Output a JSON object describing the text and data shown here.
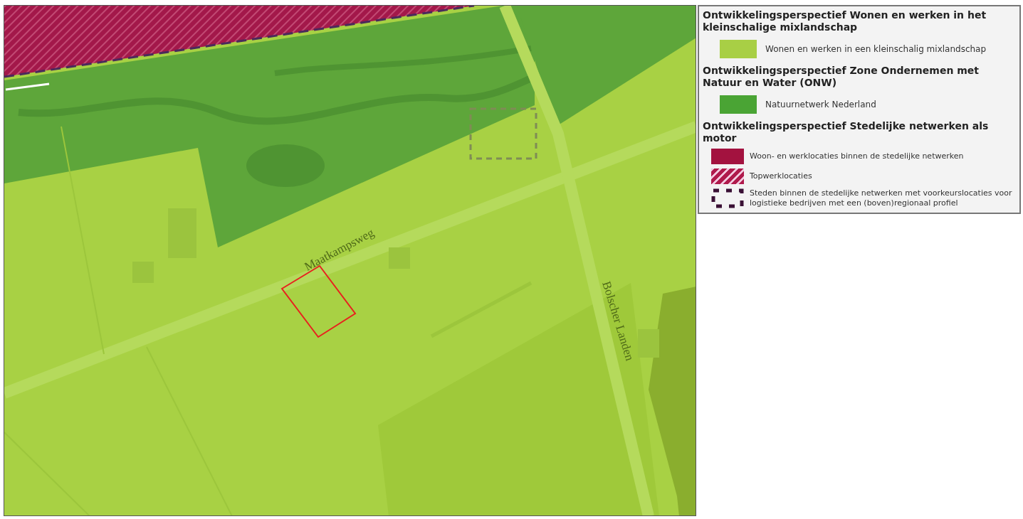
{
  "map": {
    "street_labels": [
      {
        "text": "Maatkampsweg",
        "kind": "road"
      },
      {
        "text": "Bolscher Landen",
        "kind": "road"
      }
    ]
  },
  "legend": {
    "sections": [
      {
        "title": "Ontwikkelingsperspectief Wonen en werken in het kleinschalige mixlandschap",
        "items": [
          {
            "kind": "solid",
            "color": "#a8cf45",
            "label": "Wonen en werken in een kleinschalig mixlandschap"
          }
        ]
      },
      {
        "title": "Ontwikkelingsperspectief Zone Ondernemen met Natuur en Water (ONW)",
        "items": [
          {
            "kind": "solid",
            "color": "#4aa434",
            "label": "Natuurnetwerk Nederland"
          }
        ]
      },
      {
        "title": "Ontwikkelingsperspectief Stedelijke netwerken als motor",
        "items": [
          {
            "kind": "solid",
            "color": "#a3123f",
            "label": "Woon- en werklocaties binnen de stedelijke netwerken"
          },
          {
            "kind": "hatched",
            "color": "#b01a4c",
            "label": "Topwerklocaties"
          },
          {
            "kind": "dashed",
            "color": "#3a1035",
            "label": "Steden binnen de stedelijke netwerken met voorkeurslocaties voor logistieke bedrijven met een (boven)regionaal profiel"
          }
        ]
      }
    ]
  }
}
